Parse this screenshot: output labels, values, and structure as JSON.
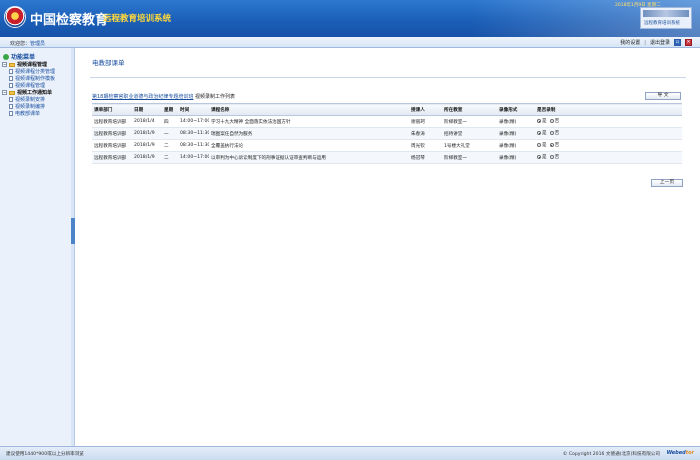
{
  "header": {
    "brand_main": "中国检察教育",
    "brand_sub": "远程教育培训系统",
    "date_text": "2018年1月9日 星期二",
    "badge_text": "远程教育培训系统"
  },
  "navbar": {
    "welcome_prefix": "欢迎您：",
    "user": "管理员",
    "my_settings": "我的设置",
    "separator": "|",
    "logout": "退出登录"
  },
  "sidebar": {
    "title": "功能菜单",
    "groups": [
      {
        "label": "视频课程管理",
        "items": [
          "视频课程分类管理",
          "视频课程制作模板",
          "视频课程管理"
        ]
      },
      {
        "label": "视频工作通知单",
        "items": [
          "视频录制安排",
          "视频录制编排",
          "电教部课单"
        ]
      }
    ]
  },
  "main": {
    "page_title": "电教部课单",
    "sub_link": "第18期检察官职业道德与政治纪律专题培训班",
    "sub_suffix": "视频录制工作列表",
    "export_button": "导 文",
    "prev_button": "上一页",
    "columns": [
      "课单部门",
      "日期",
      "星期",
      "时间",
      "课程名称",
      "授课人",
      "所在教室",
      "录像形式",
      "是否录制"
    ],
    "rows": [
      [
        "远程教育培训部",
        "2018/1/4",
        "四",
        "14:00~17:00",
        "学习十九大精神 全面落实依法治国方针",
        "谢丽珂",
        "阶梯教室一",
        "录像(精)",
        "是"
      ],
      [
        "远程教育培训部",
        "2018/1/9",
        "一",
        "08:30~11:30",
        "瑞图案任自然为服务",
        "朱春涛",
        "招待讲堂",
        "录像(精)",
        "是"
      ],
      [
        "远程教育培训部",
        "2018/1/9",
        "二",
        "08:30~11:30",
        "全覆盖执行法论",
        "周光钦",
        "1号楼大礼堂",
        "录像(精)",
        "否"
      ],
      [
        "远程教育培训部",
        "2018/1/9",
        "二",
        "14:00~17:00",
        "以审判为中心诉讼制度下的刑事证据认证审查判断与运用",
        "杨冠琴",
        "阶梯教室一",
        "录像(精)",
        "是"
      ]
    ],
    "radio_yes": "是",
    "radio_no": "否"
  },
  "footer": {
    "left": "建议使用1440*900或以上分辨率浏览",
    "right": "© Copyright 2016 文德通(北京)科技有限公司",
    "logo_main": "Webed",
    "logo_accent": "tor"
  },
  "colors": {
    "header_blue": "#1b5fb8",
    "link_blue": "#1a4fa0",
    "brand_yellow": "#ffd83a"
  }
}
